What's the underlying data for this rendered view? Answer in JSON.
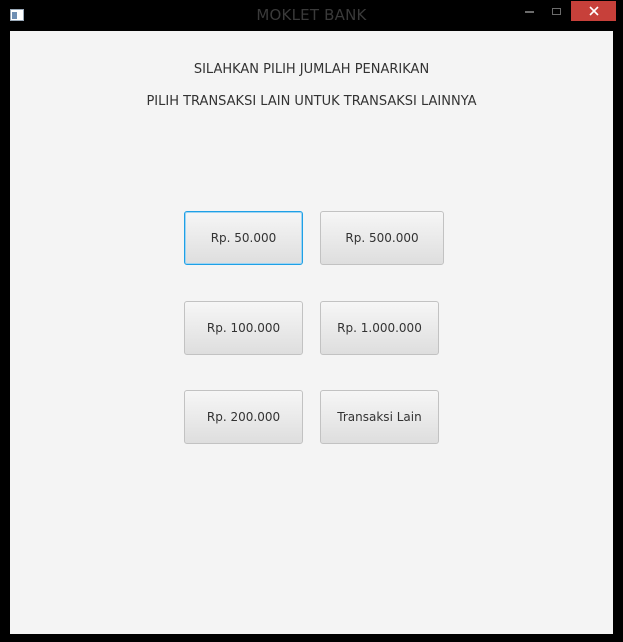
{
  "window": {
    "title": "MOKLET BANK",
    "icon": "app-window-icon",
    "controls": {
      "minimize_icon": "minimize-icon",
      "maximize_icon": "maximize-icon",
      "close_icon": "close-icon",
      "close_color": "#c7403a"
    }
  },
  "main": {
    "heading_1": "SILAHKAN PILIH JUMLAH PENARIKAN",
    "heading_2": "PILIH TRANSAKSI LAIN UNTUK TRANSAKSI LAINNYA",
    "buttons": {
      "b50k": "Rp. 50.000",
      "b500k": "Rp. 500.000",
      "b100k": "Rp. 100.000",
      "b1m": "Rp. 1.000.000",
      "b200k": "Rp. 200.000",
      "other": "Transaksi Lain"
    },
    "focused_button": "Rp. 50.000",
    "focus_color": "#1ea0e6",
    "background_color": "#f4f4f4"
  }
}
